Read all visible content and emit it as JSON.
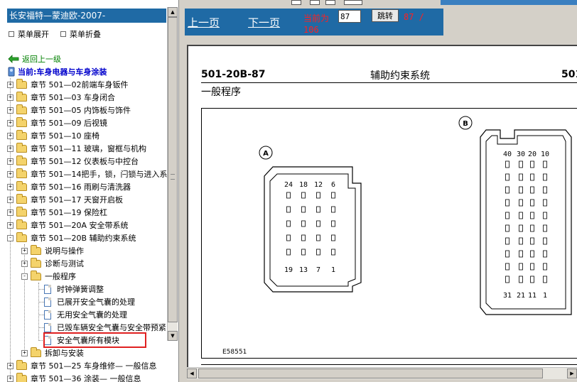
{
  "left_panel": {
    "title": "长安福特—蒙迪欧-2007-",
    "expand_all": "菜单展开",
    "collapse_all": "菜单折叠",
    "back": "返回上一级",
    "current": "当前:车身电器与车身涂装",
    "tree": [
      {
        "label": "章节 501—02前端车身钣件",
        "type": "folder",
        "state": "+",
        "level": 0
      },
      {
        "label": "章节 501—03 车身闭合",
        "type": "folder",
        "state": "+",
        "level": 0
      },
      {
        "label": "章节 501—05 内饰板与饰件",
        "type": "folder",
        "state": "+",
        "level": 0
      },
      {
        "label": "章节 501—09 后视镜",
        "type": "folder",
        "state": "+",
        "level": 0
      },
      {
        "label": "章节 501—10 座椅",
        "type": "folder",
        "state": "+",
        "level": 0
      },
      {
        "label": "章节 501—11 玻璃，窗框与机构",
        "type": "folder",
        "state": "+",
        "level": 0
      },
      {
        "label": "章节 501—12 仪表板与中控台",
        "type": "folder",
        "state": "+",
        "level": 0
      },
      {
        "label": "章节 501—14把手，锁，闩锁与进入系",
        "type": "folder",
        "state": "+",
        "level": 0
      },
      {
        "label": "章节 501—16 雨刷与清洗器",
        "type": "folder",
        "state": "+",
        "level": 0
      },
      {
        "label": "章节 501—17 天窗开启板",
        "type": "folder",
        "state": "+",
        "level": 0
      },
      {
        "label": "章节 501—19 保险杠",
        "type": "folder",
        "state": "+",
        "level": 0
      },
      {
        "label": "章节 501—20A 安全带系统",
        "type": "folder",
        "state": "+",
        "level": 0
      },
      {
        "label": "章节 501—20B 辅助约束系统",
        "type": "folder",
        "state": "-",
        "level": 0
      },
      {
        "label": "说明与操作",
        "type": "folder",
        "state": "+",
        "level": 1
      },
      {
        "label": "诊断与测试",
        "type": "folder",
        "state": "+",
        "level": 1
      },
      {
        "label": "一般程序",
        "type": "folder",
        "state": "-",
        "level": 1
      },
      {
        "label": "时钟弹簧调整",
        "type": "page",
        "state": "",
        "level": 2
      },
      {
        "label": "已展开安全气囊的处理",
        "type": "page",
        "state": "",
        "level": 2
      },
      {
        "label": "无用安全气囊的处理",
        "type": "page",
        "state": "",
        "level": 2
      },
      {
        "label": "已毁车辆安全气囊与安全带预紧",
        "type": "page",
        "state": "",
        "level": 2
      },
      {
        "label": "安全气囊所有模块",
        "type": "page",
        "state": "",
        "level": 2
      },
      {
        "label": "拆卸与安装",
        "type": "folder",
        "state": "+",
        "level": 1
      },
      {
        "label": "章节 501—25 车身维修— 一般信息",
        "type": "folder",
        "state": "+",
        "level": 0
      },
      {
        "label": "章节 501—36 涂装— 一般信息",
        "type": "folder",
        "state": "+",
        "level": 0
      }
    ]
  },
  "toolbar": {
    "prev": "上一页",
    "next": "下一页",
    "current_label": "当前为",
    "page_value": "87",
    "go": "跳转",
    "page_count": "87 /",
    "page_total": "106"
  },
  "document": {
    "code": "501-20B-87",
    "header": "辅助约束系统",
    "code_right": "501",
    "subheading": "一般程序",
    "figure_id": "E58551",
    "connector_a": {
      "label": "A",
      "top_pins": [
        "24",
        "18",
        "12",
        "6"
      ],
      "bottom_pins": [
        "19",
        "13",
        "7",
        "1"
      ]
    },
    "connector_b": {
      "label": "B",
      "top_pins": [
        "40",
        "30",
        "20",
        "10"
      ],
      "bottom_pins": [
        "31",
        "21",
        "11",
        "1"
      ]
    }
  }
}
